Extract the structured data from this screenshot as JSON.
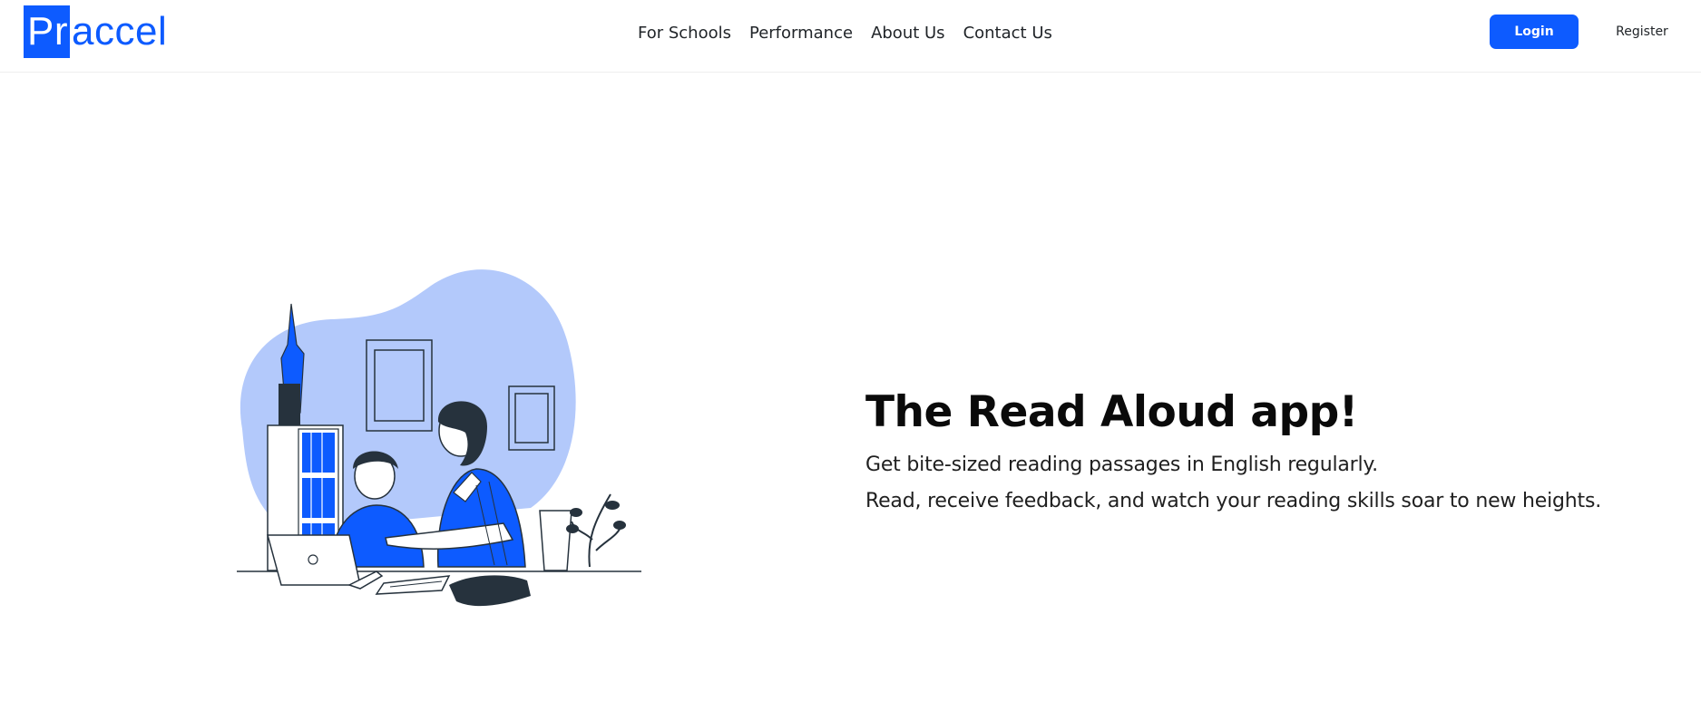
{
  "brand": {
    "logo_part1": "Pr",
    "logo_part2": "accel",
    "accent_color": "#0d5bff"
  },
  "nav": {
    "links": [
      {
        "label": "For Schools"
      },
      {
        "label": "Performance"
      },
      {
        "label": "About Us"
      },
      {
        "label": "Contact Us"
      }
    ],
    "login_label": "Login",
    "register_label": "Register"
  },
  "hero": {
    "title": "The Read Aloud app!",
    "line1": "Get bite-sized reading passages in English regularly.",
    "line2": "Read, receive feedback, and watch your reading skills soar to new heights.",
    "illustration": "father-teaching-son-at-desk-illustration"
  }
}
